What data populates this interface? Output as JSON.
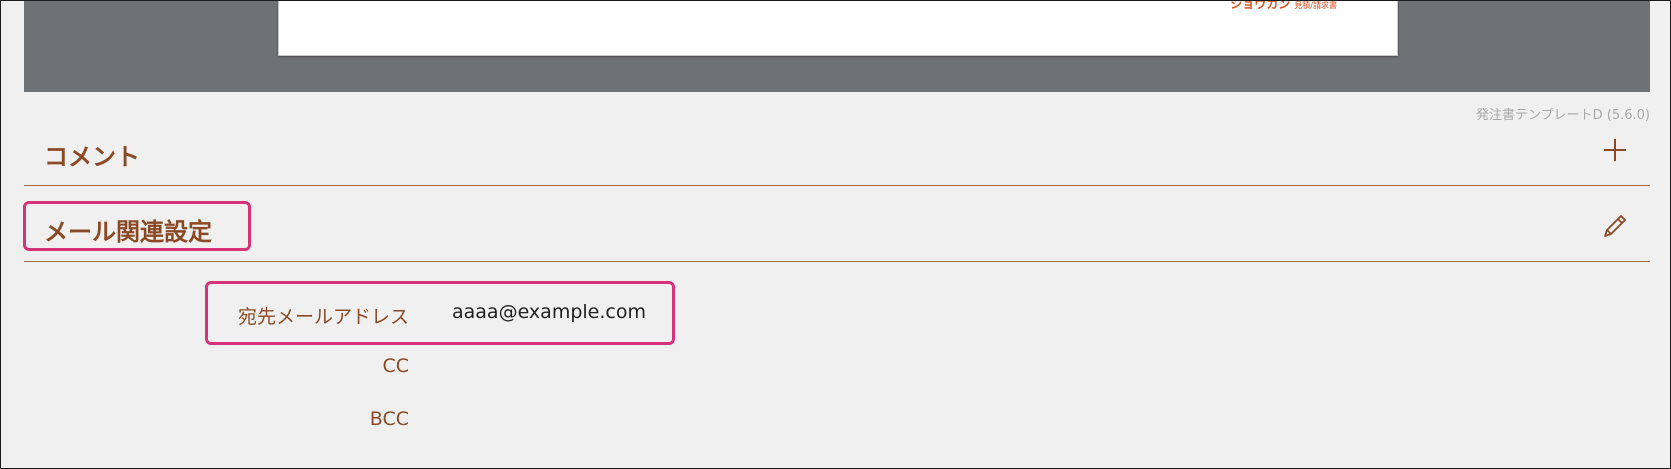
{
  "preview": {
    "company_text": "ショウカン",
    "company_subtext": "見積/請求書",
    "template_version": "発注書テンプレートD (5.6.0)"
  },
  "sections": {
    "comment": {
      "title": "コメント",
      "action_icon": "plus-icon"
    },
    "mail": {
      "title": "メール関連設定",
      "action_icon": "pencil-icon"
    }
  },
  "mail_settings": {
    "to_label": "宛先メールアドレス",
    "to_value": "aaaa@example.com",
    "cc_label": "CC",
    "cc_value": "",
    "bcc_label": "BCC",
    "bcc_value": ""
  },
  "colors": {
    "accent_brown": "#8b4a25",
    "highlight_pink": "#d6337a",
    "preview_gray": "#6f7275",
    "divider": "#a86a48"
  }
}
